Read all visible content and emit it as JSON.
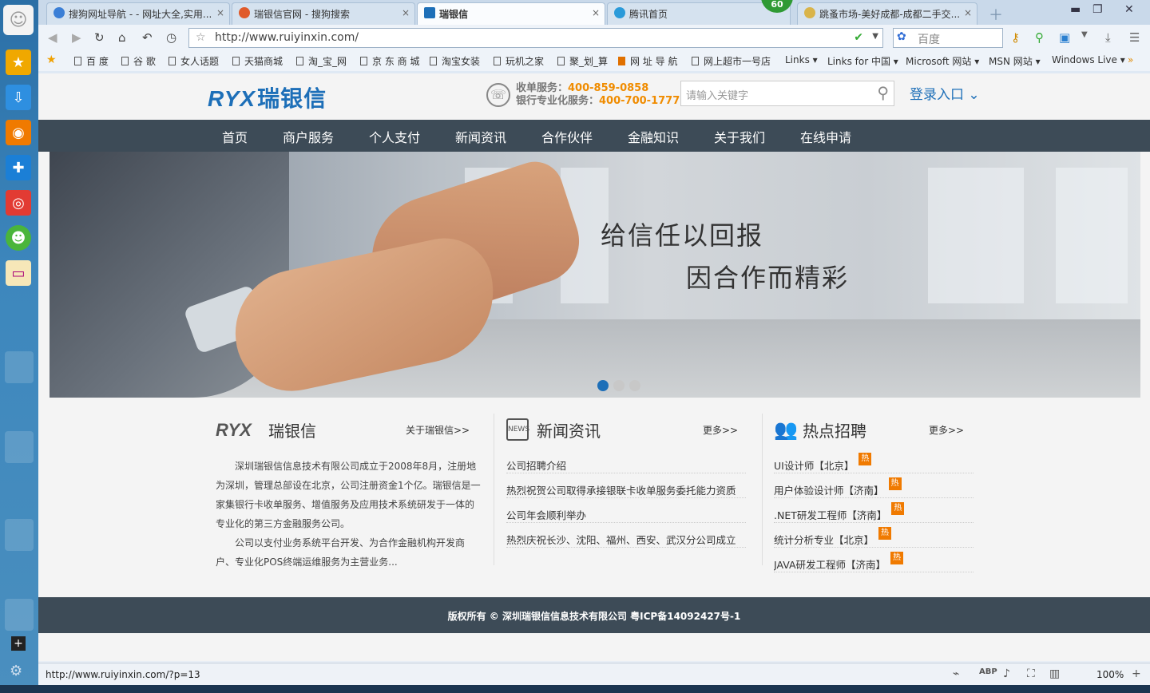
{
  "browser": {
    "tabs": [
      {
        "label": "搜狗网址导航 - - 网址大全,实用...",
        "icon_color": "#3b7fd6",
        "active": false
      },
      {
        "label": "瑞银信官网 - 搜狗搜索",
        "icon_color": "#e05a2a",
        "active": false
      },
      {
        "label": "瑞银信",
        "icon_color": "#1d6fb8",
        "active": true
      },
      {
        "label": "腾讯首页",
        "icon_color": "#2a9ad9",
        "active": false
      },
      {
        "label": "跳蚤市场-美好成都-成都二手交...",
        "icon_color": "#d9b44a",
        "active": false
      }
    ],
    "badge": "60",
    "url": "http://www.ruiyinxin.com/",
    "search_placeholder": "百度",
    "bookmarks": [
      "百 度",
      "谷 歌",
      "女人话题",
      "天猫商城",
      "淘_宝_网",
      "京 东 商 城",
      "淘宝女装",
      "玩机之家",
      "聚_划_算",
      "网 址 导 航",
      "网上超市一号店",
      "Links ▾",
      "Links for 中国 ▾",
      "Microsoft 网站 ▾",
      "MSN 网站 ▾",
      "Windows Live ▾"
    ],
    "status_url": "http://www.ruiyinxin.com/?p=13",
    "zoom": "100%"
  },
  "site": {
    "logo_latin": "RYX",
    "logo_cn": "瑞银信",
    "hotline1_label": "收单服务：",
    "hotline1_num": "400-859-0858",
    "hotline2_label": "银行专业化服务：",
    "hotline2_num": "400-700-1777",
    "search_placeholder": "请输入关键字",
    "login": "登录入口 ⌄",
    "nav": [
      "首页",
      "商户服务",
      "个人支付",
      "新闻资讯",
      "合作伙伴",
      "金融知识",
      "关于我们",
      "在线申请"
    ],
    "banner": {
      "line1": "给信任以回报",
      "line2": "因合作而精彩",
      "active_dot": 0,
      "dot_count": 3
    },
    "about": {
      "title": "瑞银信",
      "more": "关于瑞银信>>",
      "para1": "深圳瑞银信信息技术有限公司成立于2008年8月，注册地为深圳，管理总部设在北京，公司注册资金1个亿。瑞银信是一家集银行卡收单服务、增值服务及应用技术系统研发于一体的专业化的第三方金融服务公司。",
      "para2": "公司以支付业务系统平台开发、为合作金融机构开发商户、专业化POS终端运维服务为主营业务..."
    },
    "news": {
      "title": "新闻资讯",
      "more": "更多>>",
      "items": [
        "公司招聘介绍",
        "热烈祝贺公司取得承接银联卡收单服务委托能力资质",
        "公司年会顺利举办",
        "热烈庆祝长沙、沈阳、福州、西安、武汉分公司成立"
      ]
    },
    "jobs": {
      "title": "热点招聘",
      "more": "更多>>",
      "hot_label": "热",
      "items": [
        "UI设计师【北京】",
        "用户体验设计师【济南】",
        ".NET研发工程师【济南】",
        "统计分析专业【北京】",
        "JAVA研发工程师【济南】"
      ]
    },
    "footer": "版权所有 © 深圳瑞银信信息技术有限公司 粤ICP备14092427号-1"
  }
}
